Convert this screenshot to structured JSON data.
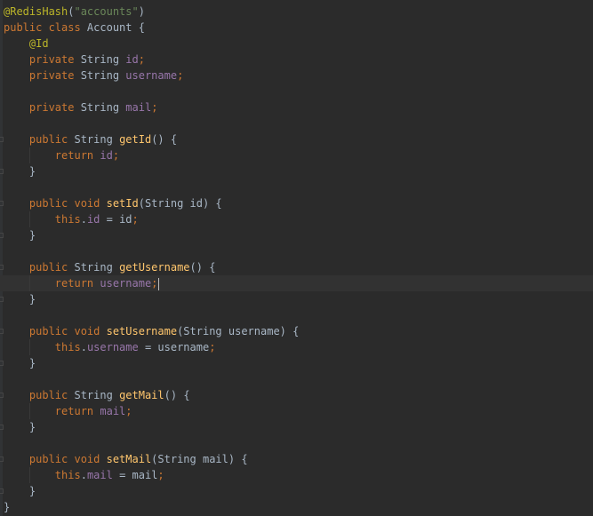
{
  "editor": {
    "theme": "darcula",
    "colors": {
      "background": "#2b2b2b",
      "keyword": "#cc7832",
      "annotation": "#bbb529",
      "string": "#6a8759",
      "field": "#9876aa",
      "method": "#ffc66d",
      "text": "#a9b7c6",
      "current_line": "#323232"
    },
    "lines": [
      [
        {
          "t": "ann",
          "v": "@RedisHash"
        },
        {
          "t": "txt",
          "v": "("
        },
        {
          "t": "str",
          "v": "\"accounts\""
        },
        {
          "t": "txt",
          "v": ")"
        }
      ],
      [
        {
          "t": "kw",
          "v": "public class "
        },
        {
          "t": "txt",
          "v": "Account {"
        }
      ],
      [
        {
          "t": "ann",
          "v": "    @Id"
        }
      ],
      [
        {
          "t": "kw",
          "v": "    private "
        },
        {
          "t": "txt",
          "v": "String "
        },
        {
          "t": "fld",
          "v": "id"
        },
        {
          "t": "semi",
          "v": ";"
        }
      ],
      [
        {
          "t": "kw",
          "v": "    private "
        },
        {
          "t": "txt",
          "v": "String "
        },
        {
          "t": "fld",
          "v": "username"
        },
        {
          "t": "semi",
          "v": ";"
        }
      ],
      [],
      [
        {
          "t": "kw",
          "v": "    private "
        },
        {
          "t": "txt",
          "v": "String "
        },
        {
          "t": "fld",
          "v": "mail"
        },
        {
          "t": "semi",
          "v": ";"
        }
      ],
      [],
      [
        {
          "t": "kw",
          "v": "    public "
        },
        {
          "t": "txt",
          "v": "String "
        },
        {
          "t": "fn",
          "v": "getId"
        },
        {
          "t": "txt",
          "v": "() {"
        }
      ],
      [
        {
          "t": "kw",
          "v": "        return "
        },
        {
          "t": "fld",
          "v": "id"
        },
        {
          "t": "semi",
          "v": ";"
        }
      ],
      [
        {
          "t": "txt",
          "v": "    }"
        }
      ],
      [],
      [
        {
          "t": "kw",
          "v": "    public void "
        },
        {
          "t": "fn",
          "v": "setId"
        },
        {
          "t": "txt",
          "v": "(String id) {"
        }
      ],
      [
        {
          "t": "kw",
          "v": "        this"
        },
        {
          "t": "txt",
          "v": "."
        },
        {
          "t": "fld",
          "v": "id"
        },
        {
          "t": "txt",
          "v": " = id"
        },
        {
          "t": "semi",
          "v": ";"
        }
      ],
      [
        {
          "t": "txt",
          "v": "    }"
        }
      ],
      [],
      [
        {
          "t": "kw",
          "v": "    public "
        },
        {
          "t": "txt",
          "v": "String "
        },
        {
          "t": "fn",
          "v": "getUsername"
        },
        {
          "t": "txt",
          "v": "() {"
        }
      ],
      [
        {
          "t": "kw",
          "v": "        return "
        },
        {
          "t": "fld",
          "v": "username"
        },
        {
          "t": "semi",
          "v": ";"
        }
      ],
      [
        {
          "t": "txt",
          "v": "    }"
        }
      ],
      [],
      [
        {
          "t": "kw",
          "v": "    public void "
        },
        {
          "t": "fn",
          "v": "setUsername"
        },
        {
          "t": "txt",
          "v": "(String username) {"
        }
      ],
      [
        {
          "t": "kw",
          "v": "        this"
        },
        {
          "t": "txt",
          "v": "."
        },
        {
          "t": "fld",
          "v": "username"
        },
        {
          "t": "txt",
          "v": " = username"
        },
        {
          "t": "semi",
          "v": ";"
        }
      ],
      [
        {
          "t": "txt",
          "v": "    }"
        }
      ],
      [],
      [
        {
          "t": "kw",
          "v": "    public "
        },
        {
          "t": "txt",
          "v": "String "
        },
        {
          "t": "fn",
          "v": "getMail"
        },
        {
          "t": "txt",
          "v": "() {"
        }
      ],
      [
        {
          "t": "kw",
          "v": "        return "
        },
        {
          "t": "fld",
          "v": "mail"
        },
        {
          "t": "semi",
          "v": ";"
        }
      ],
      [
        {
          "t": "txt",
          "v": "    }"
        }
      ],
      [],
      [
        {
          "t": "kw",
          "v": "    public void "
        },
        {
          "t": "fn",
          "v": "setMail"
        },
        {
          "t": "txt",
          "v": "(String mail) {"
        }
      ],
      [
        {
          "t": "kw",
          "v": "        this"
        },
        {
          "t": "txt",
          "v": "."
        },
        {
          "t": "fld",
          "v": "mail"
        },
        {
          "t": "txt",
          "v": " = mail"
        },
        {
          "t": "semi",
          "v": ";"
        }
      ],
      [
        {
          "t": "txt",
          "v": "    }"
        }
      ],
      [
        {
          "t": "txt",
          "v": "}"
        }
      ]
    ]
  }
}
